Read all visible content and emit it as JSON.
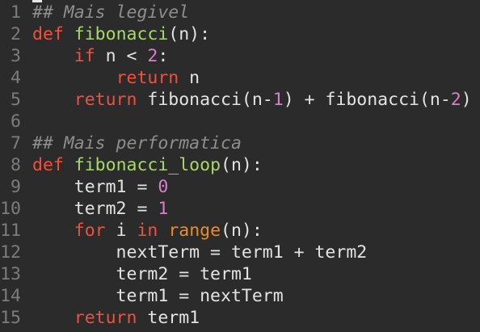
{
  "editor": {
    "colors": {
      "background": "#2b2b2b",
      "keyword": "#f0503c",
      "function": "#a6d96a",
      "builtin": "#f08a24",
      "number": "#d77fc8",
      "comment": "#8e8e8e",
      "plain": "#e3e3e3",
      "line_number": "#7c7c7c"
    },
    "lines": [
      {
        "n": "1",
        "tokens": [
          {
            "t": "## Mais legivel",
            "c": "cm"
          }
        ]
      },
      {
        "n": "2",
        "tokens": [
          {
            "t": "def",
            "c": "kw"
          },
          {
            "t": " ",
            "c": "pl"
          },
          {
            "t": "fibonacci",
            "c": "fn"
          },
          {
            "t": "(n):",
            "c": "pl"
          }
        ]
      },
      {
        "n": "3",
        "tokens": [
          {
            "t": "    ",
            "c": "pl"
          },
          {
            "t": "if",
            "c": "kw"
          },
          {
            "t": " n < ",
            "c": "pl"
          },
          {
            "t": "2",
            "c": "num"
          },
          {
            "t": ":",
            "c": "pl"
          }
        ]
      },
      {
        "n": "4",
        "tokens": [
          {
            "t": "        ",
            "c": "pl"
          },
          {
            "t": "return",
            "c": "kw"
          },
          {
            "t": " n",
            "c": "pl"
          }
        ]
      },
      {
        "n": "5",
        "tokens": [
          {
            "t": "    ",
            "c": "pl"
          },
          {
            "t": "return",
            "c": "kw"
          },
          {
            "t": " fibonacci(n-",
            "c": "pl"
          },
          {
            "t": "1",
            "c": "num"
          },
          {
            "t": ") + fibonacci(n-",
            "c": "pl"
          },
          {
            "t": "2",
            "c": "num"
          },
          {
            "t": ")",
            "c": "pl"
          }
        ]
      },
      {
        "n": "6",
        "tokens": []
      },
      {
        "n": "7",
        "tokens": [
          {
            "t": "## Mais performatica",
            "c": "cm"
          }
        ]
      },
      {
        "n": "8",
        "tokens": [
          {
            "t": "def",
            "c": "kw"
          },
          {
            "t": " ",
            "c": "pl"
          },
          {
            "t": "fibonacci_loop",
            "c": "fn"
          },
          {
            "t": "(n):",
            "c": "pl"
          }
        ]
      },
      {
        "n": "9",
        "tokens": [
          {
            "t": "    term1 = ",
            "c": "pl"
          },
          {
            "t": "0",
            "c": "num"
          }
        ]
      },
      {
        "n": "10",
        "tokens": [
          {
            "t": "    term2 = ",
            "c": "pl"
          },
          {
            "t": "1",
            "c": "num"
          }
        ]
      },
      {
        "n": "11",
        "tokens": [
          {
            "t": "    ",
            "c": "pl"
          },
          {
            "t": "for",
            "c": "kw"
          },
          {
            "t": " i ",
            "c": "pl"
          },
          {
            "t": "in",
            "c": "kw"
          },
          {
            "t": " ",
            "c": "pl"
          },
          {
            "t": "range",
            "c": "bi"
          },
          {
            "t": "(n):",
            "c": "pl"
          }
        ]
      },
      {
        "n": "12",
        "tokens": [
          {
            "t": "        nextTerm = term1 + term2",
            "c": "pl"
          }
        ]
      },
      {
        "n": "13",
        "tokens": [
          {
            "t": "        term2 = term1",
            "c": "pl"
          }
        ]
      },
      {
        "n": "14",
        "tokens": [
          {
            "t": "        term1 = nextTerm",
            "c": "pl"
          }
        ]
      },
      {
        "n": "15",
        "tokens": [
          {
            "t": "    ",
            "c": "pl"
          },
          {
            "t": "return",
            "c": "kw"
          },
          {
            "t": " term1",
            "c": "pl"
          }
        ]
      }
    ]
  }
}
